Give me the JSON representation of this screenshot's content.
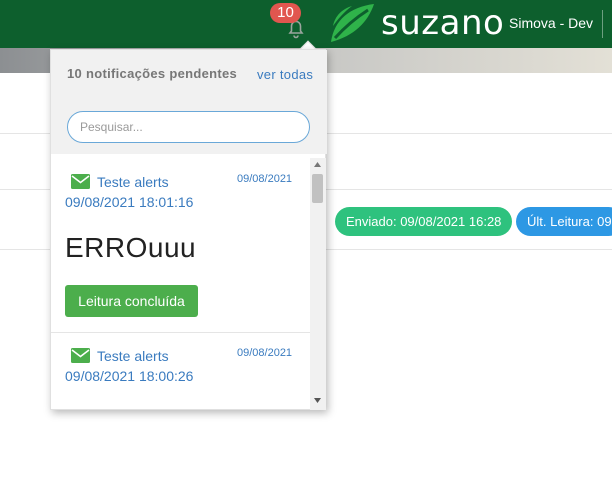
{
  "header": {
    "notification_count": "10",
    "logo_text": "suzano",
    "user_name": "Simova - Dev",
    "brand_color": "#0d5f2d",
    "badge_color": "#e1564f"
  },
  "status": {
    "sent_label": "Enviado: 09/08/2021 16:28",
    "read_label": "Últ. Leitura: 09",
    "sent_color": "#2ec27e",
    "read_color": "#2d98e4"
  },
  "notifications_panel": {
    "title": "10 notificações pendentes",
    "view_all": "ver todas",
    "search_placeholder": "Pesquisar...",
    "items": [
      {
        "icon": "envelope-icon",
        "subject": "Teste alerts",
        "date": "09/08/2021",
        "datetime": "09/08/2021 18:01:16",
        "body": "ERROuuu",
        "action": "Leitura concluída"
      },
      {
        "icon": "envelope-icon",
        "subject": "Teste alerts",
        "date": "09/08/2021",
        "datetime": "09/08/2021 18:00:26"
      }
    ]
  }
}
